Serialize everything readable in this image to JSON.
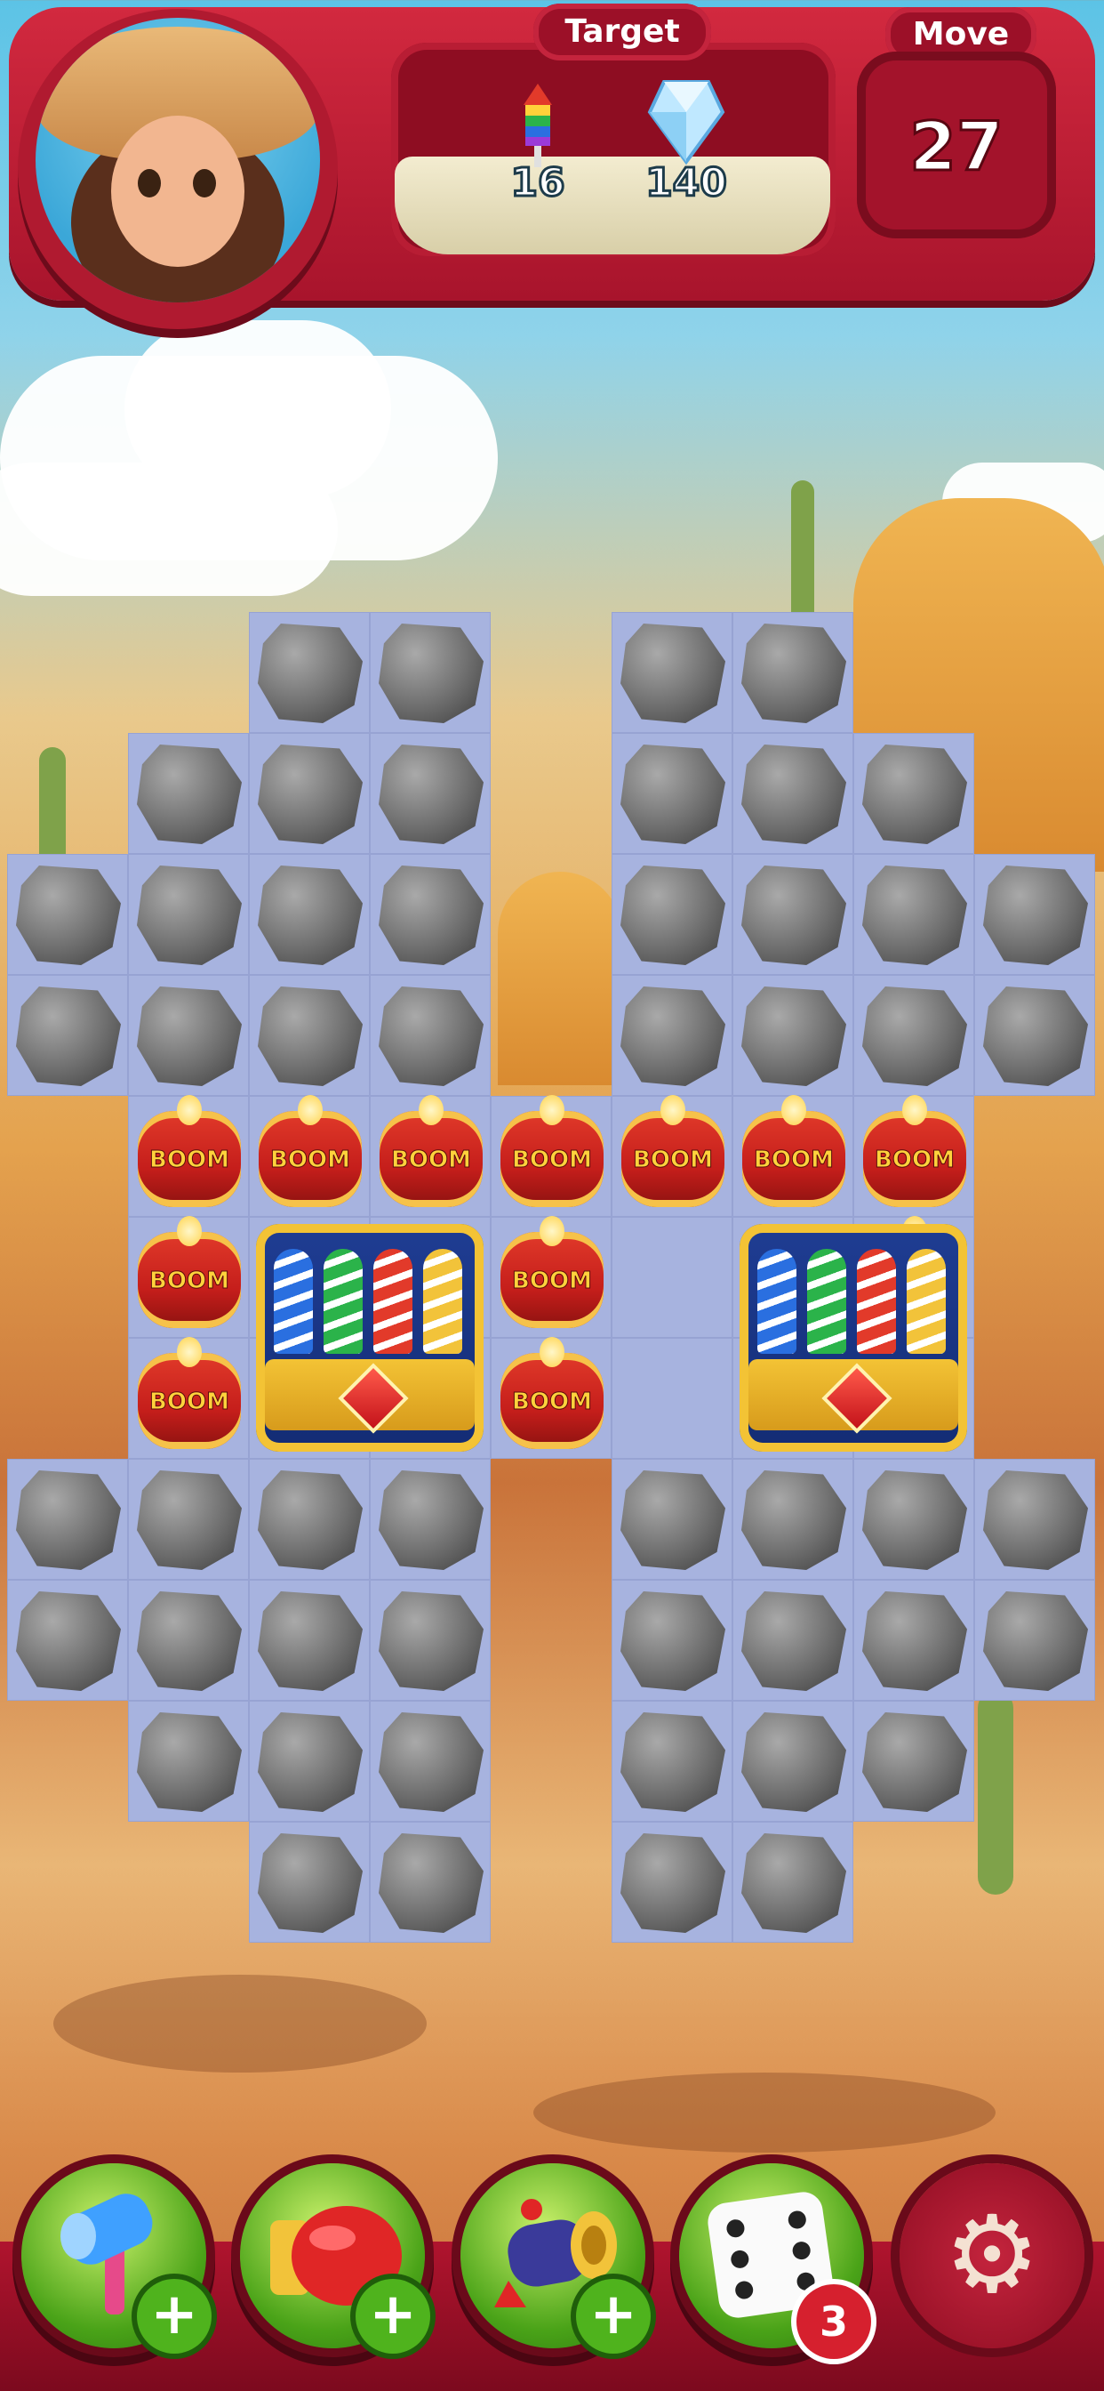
{
  "hud": {
    "target_label": "Target",
    "move_label": "Move",
    "moves_left": "27",
    "targets": [
      {
        "icon": "rocket-icon",
        "count": "16"
      },
      {
        "icon": "crystal-icon",
        "count": "140"
      }
    ]
  },
  "board": {
    "barrel_label": "BOOM"
  },
  "boosters": {
    "plus": "+",
    "dice_count": "3",
    "items": [
      {
        "name": "hammer-icon"
      },
      {
        "name": "boxing-glove-icon"
      },
      {
        "name": "cannon-icon"
      },
      {
        "name": "dice-icon"
      },
      {
        "name": "gear-icon"
      }
    ]
  },
  "colors": {
    "hud_red": "#c01d35",
    "cell": "#a7b3df",
    "frame_gold": "#e9b845",
    "booster_green": "#4aa318"
  }
}
